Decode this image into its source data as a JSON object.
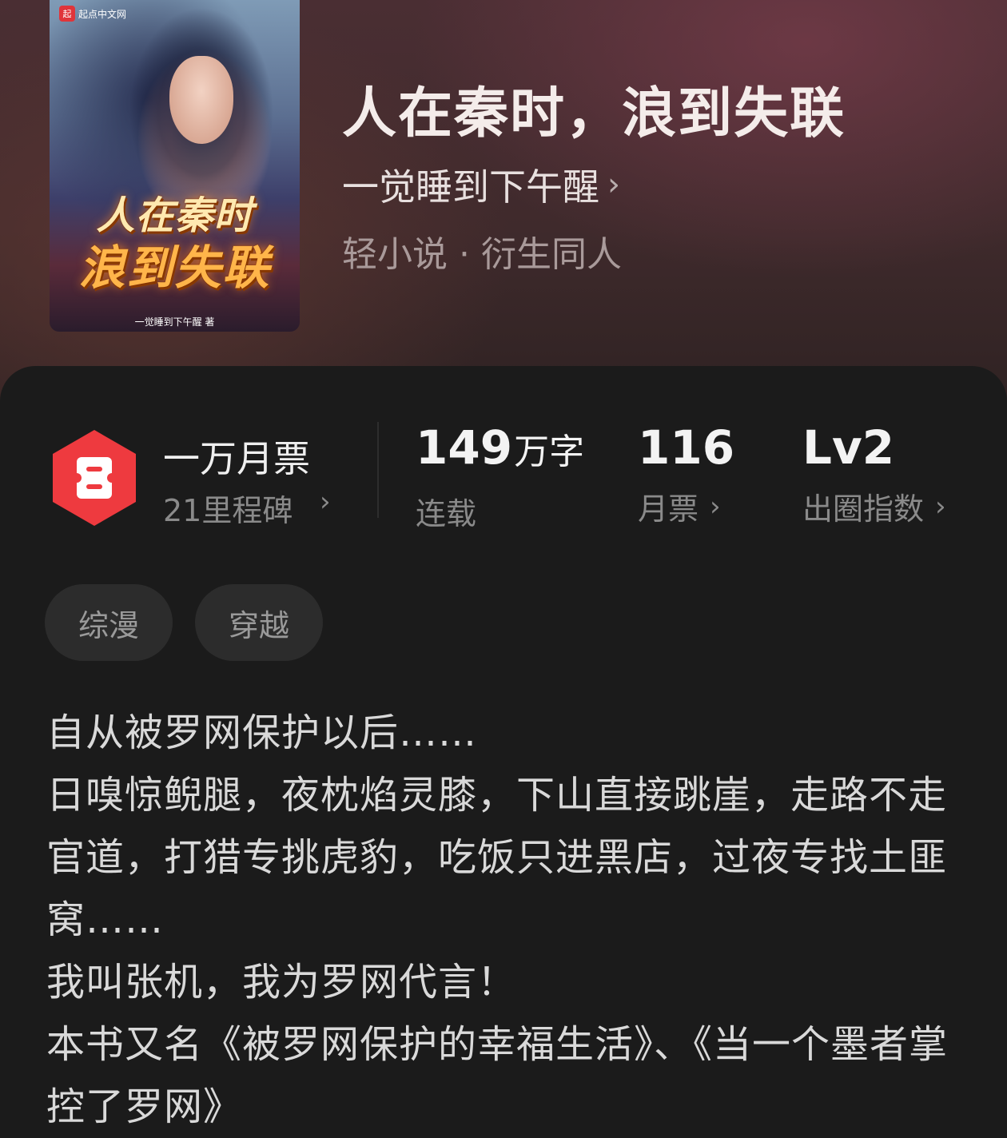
{
  "book": {
    "title": "人在秦时，浪到失联",
    "author": "一觉睡到下午醒",
    "category": "轻小说 · 衍生同人",
    "cover": {
      "logo_mark": "起",
      "logo_text": "起点中文网",
      "title_line1": "人在秦时",
      "title_line2": "浪到失联",
      "author_credit": "一觉睡到下午醒 著"
    }
  },
  "stats": {
    "milestone_title": "一万月票",
    "milestone_sub": "21里程碑",
    "words_value": "149",
    "words_unit": "万字",
    "words_label": "连载",
    "votes_value": "116",
    "votes_label": "月票",
    "level_value": "Lv2",
    "level_label": "出圈指数"
  },
  "tags": [
    "综漫",
    "穿越"
  ],
  "description": [
    "自从被罗网保护以后……",
    "日嗅惊鲵腿，夜枕焰灵膝，下山直接跳崖，走路不走官道，打猎专挑虎豹，吃饭只进黑店，过夜专找土匪窝……",
    "我叫张机，我为罗网代言！",
    "本书又名《被罗网保护的幸福生活》、《当一个墨者掌控了罗网》"
  ],
  "colors": {
    "accent_red": "#ee3a3f",
    "background": "#1b1b1b",
    "tag_bg": "#2c2c2c"
  },
  "icons": {
    "chevron": "chevron-right-icon",
    "ticket": "monthly-ticket-icon"
  }
}
